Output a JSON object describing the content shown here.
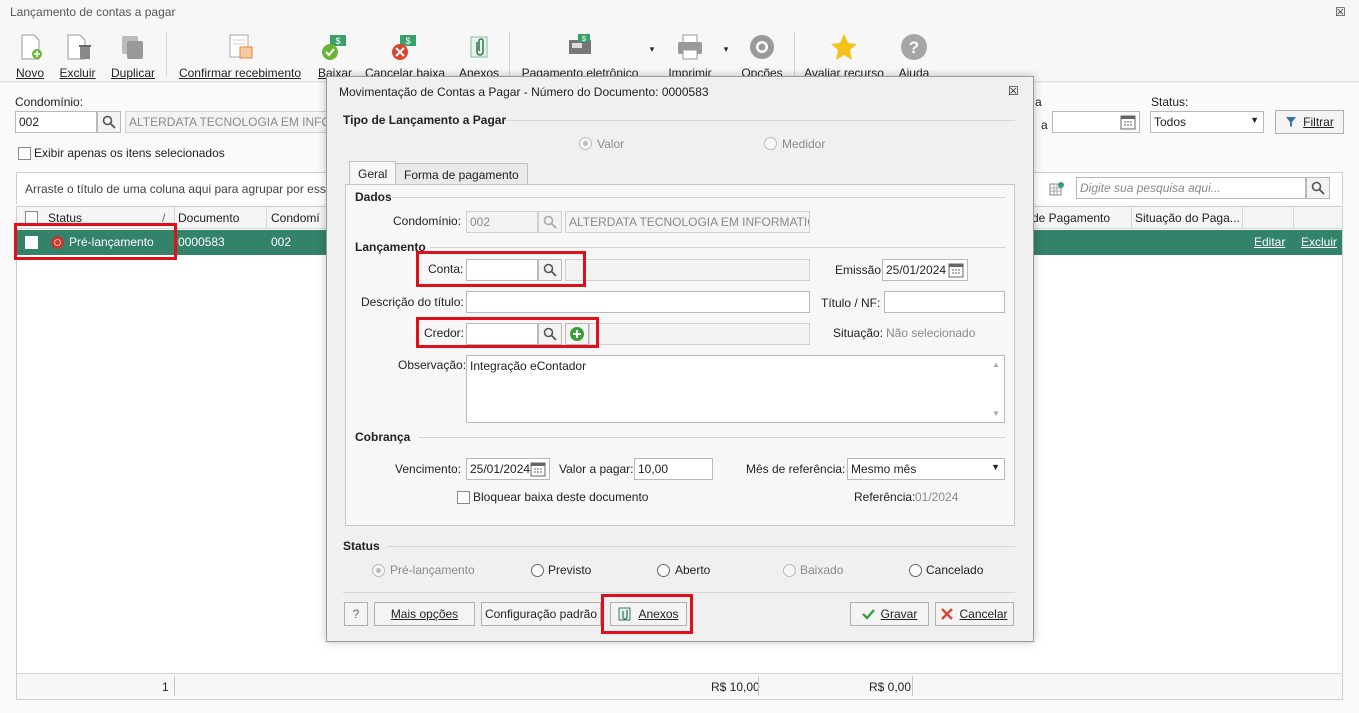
{
  "window": {
    "title": "Lançamento de contas a pagar",
    "close": "☒"
  },
  "toolbar": {
    "novo": "Novo",
    "excluir": "Excluir",
    "duplicar": "Duplicar",
    "confirmar": "Confirmar recebimento",
    "baixar": "Baixar",
    "cancelar_baixa": "Cancelar baixa",
    "anexos": "Anexos",
    "pagamento": "Pagamento eletrônico",
    "imprimir": "Imprimir",
    "opcoes": "Opções",
    "avaliar": "Avaliar recurso",
    "ajuda": "Ajuda"
  },
  "filters": {
    "condominio_label": "Condomínio:",
    "condominio_code": "002",
    "condominio_name": "ALTERDATA TECNOLOGIA EM INFORM",
    "status_label": "Status:",
    "status_value": "Todos",
    "range_a": "a",
    "filtrar": "Filtrar",
    "exibir_selecionados": "Exibir apenas os itens selecionados",
    "group_hint": "Arraste o título de uma coluna aqui para agrupar por essa",
    "search_placeholder": "Digite sua pesquisa aqui..."
  },
  "grid": {
    "columns": [
      "Status",
      "Documento",
      "Condomí",
      "de Pagamento",
      "Situação do Paga..."
    ],
    "sort_mark": "/",
    "row": {
      "status": "Pré-lançamento",
      "documento": "0000583",
      "condominio": "002",
      "editar": "Editar",
      "excluir": "Excluir"
    },
    "footer": {
      "count": "1",
      "total1": "R$ 10,00",
      "total2": "R$ 0,00"
    }
  },
  "dialog": {
    "title": "Movimentação de Contas a Pagar - Número do Documento: 0000583",
    "tipo_section": "Tipo de Lançamento a Pagar",
    "tipo_valor": "Valor",
    "tipo_medidor": "Medidor",
    "tabs": [
      "Geral",
      "Forma de pagamento"
    ],
    "dados_section": "Dados",
    "condominio_label": "Condomínio:",
    "condominio_code": "002",
    "condominio_name": "ALTERDATA TECNOLOGIA EM INFORMATICA L",
    "lancamento_section": "Lançamento",
    "conta_label": "Conta:",
    "emissao_label": "Emissão:",
    "emissao_value": "25/01/2024",
    "descricao_label": "Descrição do título:",
    "titulo_nf_label": "Título / NF:",
    "credor_label": "Credor:",
    "situacao_label": "Situação:",
    "situacao_value": "Não selecionado",
    "observacao_label": "Observação:",
    "observacao_value": "Integração eContador",
    "cobranca_section": "Cobrança",
    "vencimento_label": "Vencimento:",
    "vencimento_value": "25/01/2024",
    "valor_label": "Valor a pagar:",
    "valor_value": "10,00",
    "mes_label": "Mês de referência:",
    "mes_value": "Mesmo mês",
    "bloquear_label": "Bloquear baixa deste documento",
    "referencia_label": "Referência:",
    "referencia_value": "01/2024",
    "status_section": "Status",
    "status_options": [
      "Pré-lançamento",
      "Previsto",
      "Aberto",
      "Baixado",
      "Cancelado"
    ],
    "help": "?",
    "mais_opcoes": "Mais opções",
    "config_padrao": "Configuração padrão",
    "anexos": "Anexos",
    "gravar": "Gravar",
    "cancelar": "Cancelar"
  },
  "colors": {
    "selected_row": "#33826a",
    "highlight": "#e0101a",
    "accent_green": "#3aa13a"
  }
}
